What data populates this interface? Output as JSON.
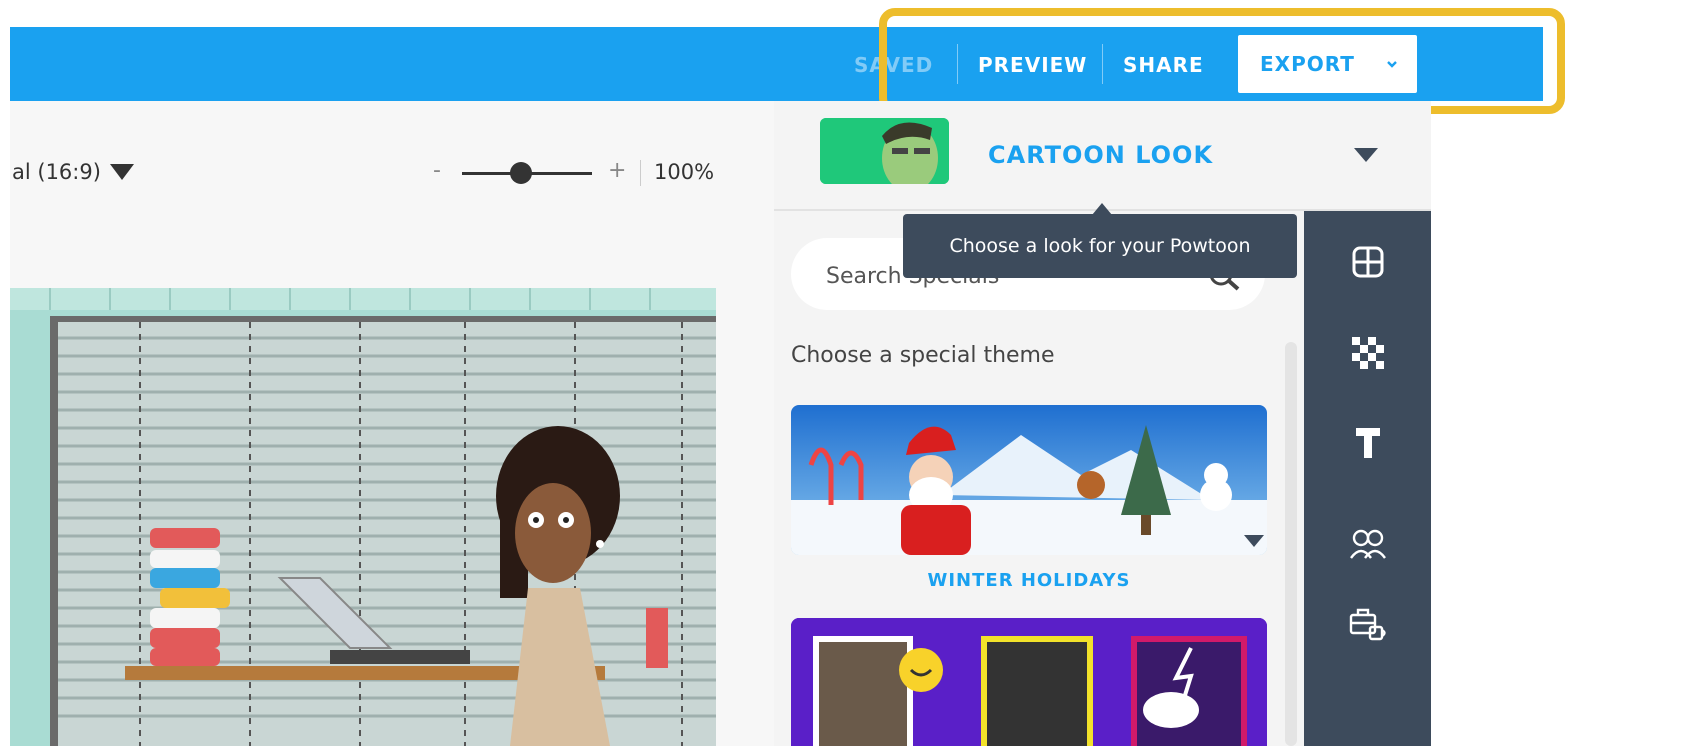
{
  "topbar": {
    "saved_label": "SAVED",
    "preview_label": "PREVIEW",
    "share_label": "SHARE",
    "export_label": "EXPORT",
    "bar_color": "#1aa1f0",
    "highlight_color": "#edbd2c"
  },
  "canvas": {
    "aspect_label": "al (16:9)",
    "zoom_minus": "-",
    "zoom_plus": "+",
    "zoom_value": "100%",
    "zoom_level": 0.45
  },
  "look": {
    "title": "CARTOON LOOK",
    "tooltip": "Choose a look for your Powtoon",
    "thumb_icon": "cartoon-look-thumbnail"
  },
  "specials": {
    "search_placeholder": "Search Specials",
    "header": "Choose a special theme",
    "themes": [
      {
        "label": "WINTER HOLIDAYS"
      },
      {
        "label": ""
      }
    ]
  },
  "rail": {
    "icons": [
      "layout-icon",
      "background-pattern-icon",
      "text-icon",
      "characters-icon",
      "props-icon"
    ]
  }
}
